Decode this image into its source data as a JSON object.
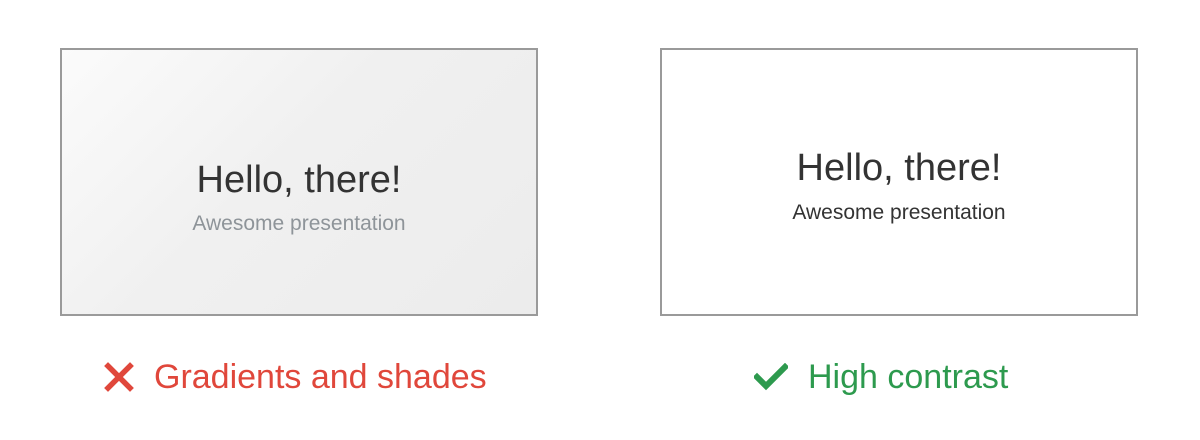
{
  "bad_example": {
    "slide_title": "Hello, there!",
    "slide_subtitle": "Awesome presentation",
    "caption": "Gradients and shades",
    "icon": "cross-icon",
    "color": "#e0473b"
  },
  "good_example": {
    "slide_title": "Hello, there!",
    "slide_subtitle": "Awesome presentation",
    "caption": "High contrast",
    "icon": "checkmark-icon",
    "color": "#2d9a4e"
  }
}
